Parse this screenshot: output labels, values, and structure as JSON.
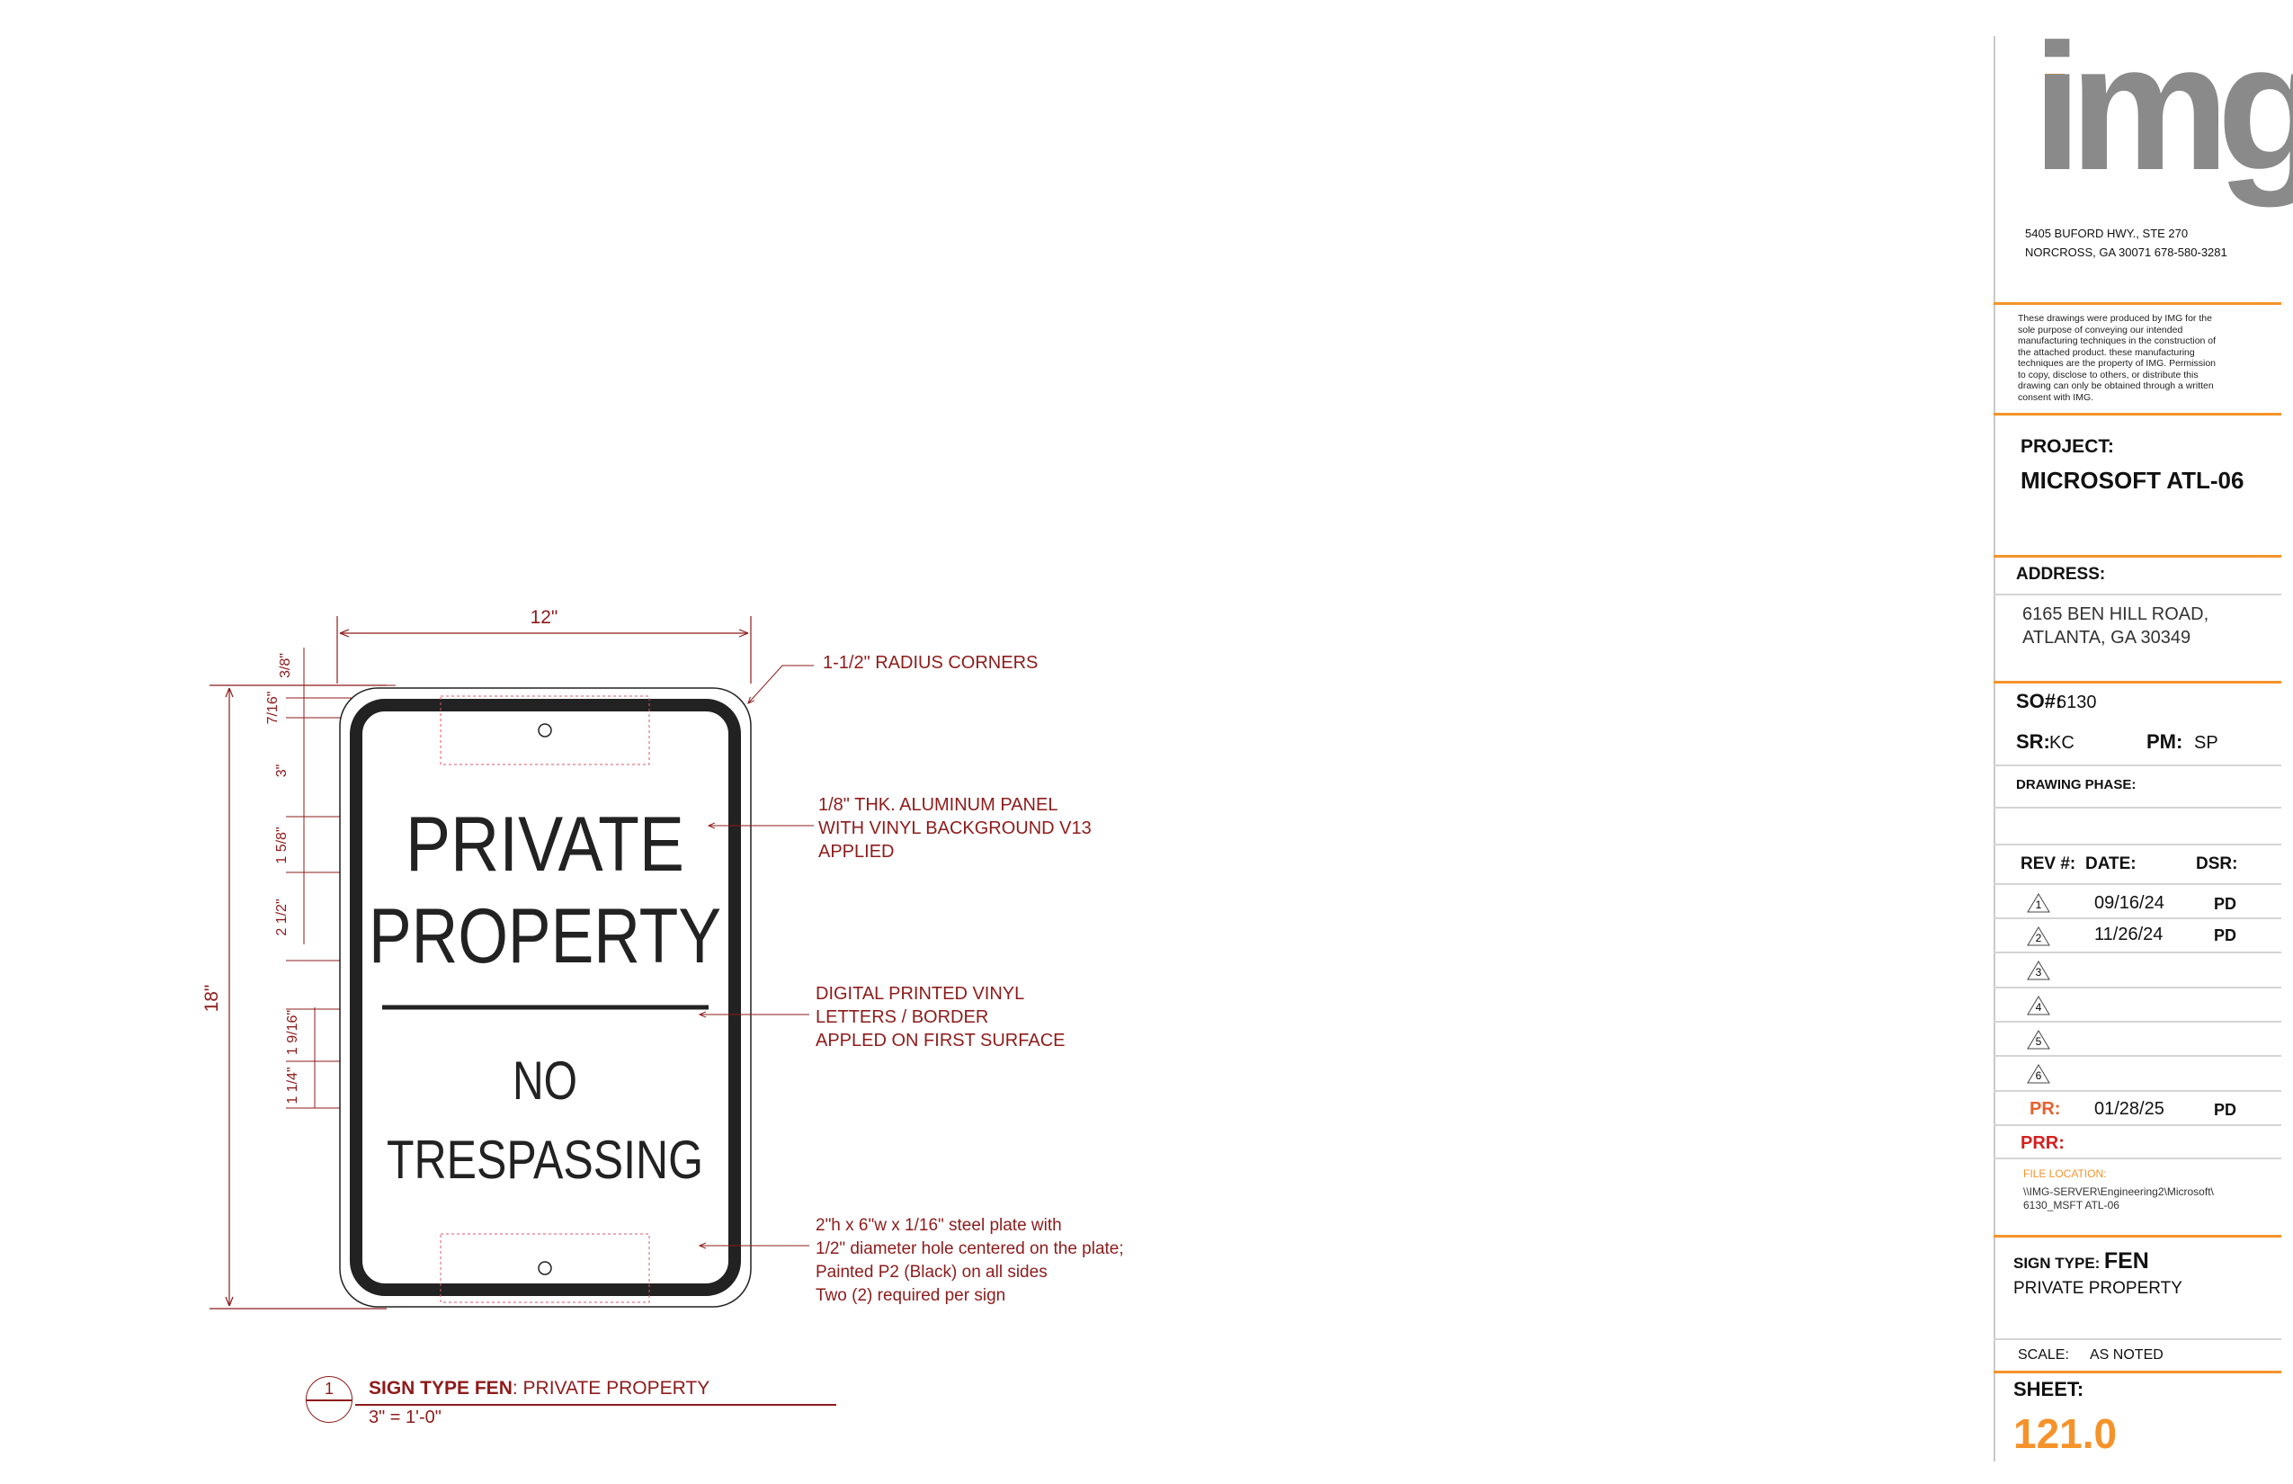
{
  "drawing": {
    "width_dim": "12\"",
    "height_dim": "18\"",
    "dims_left": [
      "3/8\"",
      "7/16\"",
      "3\"",
      "1 5/8\"",
      "2 1/2\"",
      "1 9/16\"",
      "1 1/4\""
    ],
    "sign_text": {
      "line1": "PRIVATE",
      "line2": "PROPERTY",
      "line3": "NO",
      "line4": "TRESPASSING"
    },
    "callouts": {
      "radius": "1-1/2\" RADIUS CORNERS",
      "panel": [
        "1/8\" THK. ALUMINUM PANEL",
        "WITH VINYL BACKGROUND V13",
        "APPLIED"
      ],
      "vinyl": [
        "DIGITAL PRINTED VINYL",
        "LETTERS / BORDER",
        "APPLED ON FIRST SURFACE"
      ],
      "plate": [
        "2\"h x 6\"w x 1/16\" steel plate with",
        "1/2\" diameter hole centered on the plate;",
        "Painted P2 (Black) on all sides",
        "Two (2) required per sign"
      ]
    },
    "detail_tag": {
      "number": "1",
      "title_bold": "SIGN TYPE FEN",
      "title_rest": ": PRIVATE PROPERTY",
      "scale": "3\" = 1'-0\""
    }
  },
  "title_block": {
    "logo_text": "img",
    "address_line1": "5405 BUFORD HWY., STE 270",
    "address_line2": "NORCROSS, GA 30071   678-580-3281",
    "disclaimer": [
      "These drawings were produced by IMG for the",
      "sole purpose of conveying our intended",
      "manufacturing techniques in the construction of",
      "the attached product. these manufacturing",
      "techniques are the property of IMG. Permission",
      "to copy, disclose to others, or distribute this",
      "drawing can only be obtained through a written",
      "consent with IMG."
    ],
    "project_label": "PROJECT:",
    "project_name": "MICROSOFT ATL-06",
    "address_label": "ADDRESS:",
    "site_address1": "6165 BEN HILL ROAD,",
    "site_address2": "ATLANTA, GA 30349",
    "so_label": "SO#:",
    "so_value": "6130",
    "sr_label": "SR:",
    "sr_value": "KC",
    "pm_label": "PM:",
    "pm_value": "SP",
    "phase_label": "DRAWING PHASE:",
    "rev_headers": [
      "REV #:",
      "DATE:",
      "DSR:"
    ],
    "revisions": [
      {
        "num": "1",
        "date": "09/16/24",
        "dsr": "PD"
      },
      {
        "num": "2",
        "date": "11/26/24",
        "dsr": "PD"
      },
      {
        "num": "3",
        "date": "",
        "dsr": ""
      },
      {
        "num": "4",
        "date": "",
        "dsr": ""
      },
      {
        "num": "5",
        "date": "",
        "dsr": ""
      },
      {
        "num": "6",
        "date": "",
        "dsr": ""
      }
    ],
    "pr_label": "PR:",
    "pr_date": "01/28/25",
    "pr_dsr": "PD",
    "prr_label": "PRR:",
    "file_label": "FILE LOCATION:",
    "file_path1": "\\\\IMG-SERVER\\Engineering2\\Microsoft\\",
    "file_path2": "6130_MSFT ATL-06",
    "sign_type_label": "SIGN TYPE:",
    "sign_type_value": "FEN",
    "sign_type_desc": "PRIVATE PROPERTY",
    "scale_label": "SCALE:",
    "scale_value": "AS NOTED",
    "sheet_label": "SHEET:",
    "sheet_value": "121.0",
    "colors": {
      "accent": "#f5932a",
      "logo_gray": "#8a8a8a",
      "callout_red": "#8e1b1b",
      "pr_orange": "#e8602c",
      "prr_red": "#d42020"
    }
  }
}
